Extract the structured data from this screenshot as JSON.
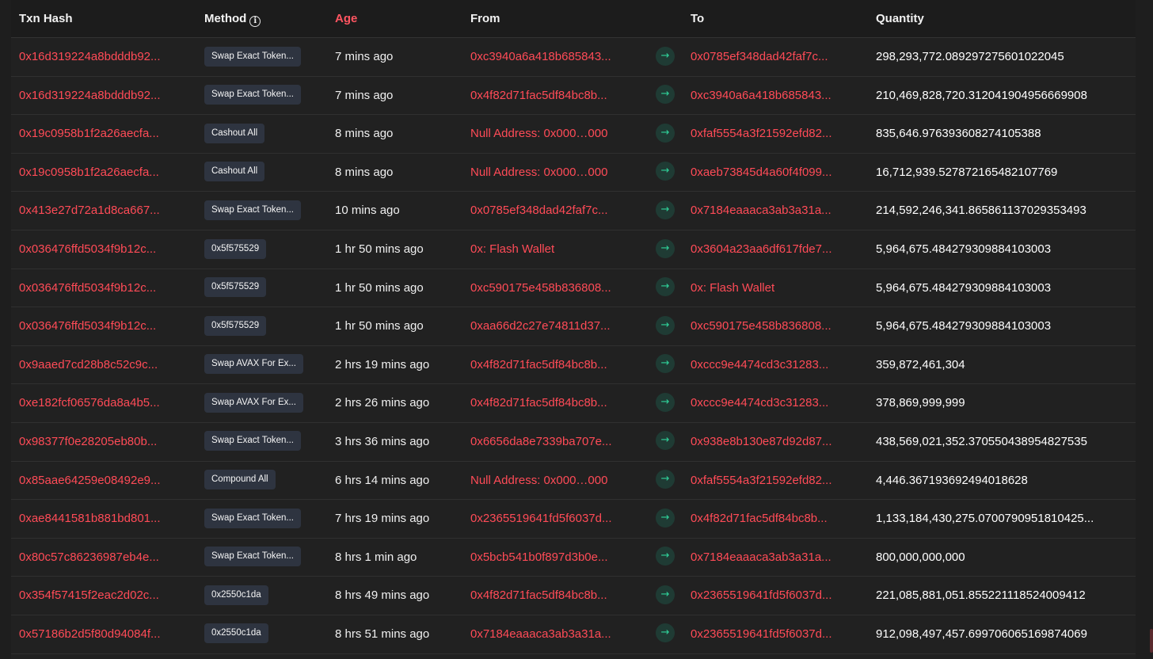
{
  "header": {
    "txn_hash": "Txn Hash",
    "method": "Method",
    "age": "Age",
    "from": "From",
    "to": "To",
    "quantity": "Quantity"
  },
  "colors": {
    "accent_red": "#ff4b57",
    "arrow_green": "#2fd39a",
    "badge_bg": "#2e3440"
  },
  "rows": [
    {
      "hash": "0x16d319224a8bdddb92...",
      "method": "Swap Exact Token...",
      "age": "7 mins ago",
      "from": "0xc3940a6a418b685843...",
      "to": "0x0785ef348dad42faf7c...",
      "quantity": "298,293,772.089297275601022045"
    },
    {
      "hash": "0x16d319224a8bdddb92...",
      "method": "Swap Exact Token...",
      "age": "7 mins ago",
      "from": "0x4f82d71fac5df84bc8b...",
      "to": "0xc3940a6a418b685843...",
      "quantity": "210,469,828,720.312041904956669908"
    },
    {
      "hash": "0x19c0958b1f2a26aecfa...",
      "method": "Cashout All",
      "age": "8 mins ago",
      "from": "Null Address: 0x000…000",
      "to": "0xfaf5554a3f21592efd82...",
      "quantity": "835,646.976393608274105388"
    },
    {
      "hash": "0x19c0958b1f2a26aecfa...",
      "method": "Cashout All",
      "age": "8 mins ago",
      "from": "Null Address: 0x000…000",
      "to": "0xaeb73845d4a60f4f099...",
      "quantity": "16,712,939.527872165482107769"
    },
    {
      "hash": "0x413e27d72a1d8ca667...",
      "method": "Swap Exact Token...",
      "age": "10 mins ago",
      "from": "0x0785ef348dad42faf7c...",
      "to": "0x7184eaaaca3ab3a31a...",
      "quantity": "214,592,246,341.865861137029353493"
    },
    {
      "hash": "0x036476ffd5034f9b12c...",
      "method": "0x5f575529",
      "age": "1 hr 50 mins ago",
      "from": "0x: Flash Wallet",
      "to": "0x3604a23aa6df617fde7...",
      "quantity": "5,964,675.484279309884103003"
    },
    {
      "hash": "0x036476ffd5034f9b12c...",
      "method": "0x5f575529",
      "age": "1 hr 50 mins ago",
      "from": "0xc590175e458b836808...",
      "to": "0x: Flash Wallet",
      "quantity": "5,964,675.484279309884103003"
    },
    {
      "hash": "0x036476ffd5034f9b12c...",
      "method": "0x5f575529",
      "age": "1 hr 50 mins ago",
      "from": "0xaa66d2c27e74811d37...",
      "to": "0xc590175e458b836808...",
      "quantity": "5,964,675.484279309884103003"
    },
    {
      "hash": "0x9aaed7cd28b8c52c9c...",
      "method": "Swap AVAX For Ex...",
      "age": "2 hrs 19 mins ago",
      "from": "0x4f82d71fac5df84bc8b...",
      "to": "0xccc9e4474cd3c31283...",
      "quantity": "359,872,461,304"
    },
    {
      "hash": "0xe182fcf06576da8a4b5...",
      "method": "Swap AVAX For Ex...",
      "age": "2 hrs 26 mins ago",
      "from": "0x4f82d71fac5df84bc8b...",
      "to": "0xccc9e4474cd3c31283...",
      "quantity": "378,869,999,999"
    },
    {
      "hash": "0x98377f0e28205eb80b...",
      "method": "Swap Exact Token...",
      "age": "3 hrs 36 mins ago",
      "from": "0x6656da8e7339ba707e...",
      "to": "0x938e8b130e87d92d87...",
      "quantity": "438,569,021,352.370550438954827535"
    },
    {
      "hash": "0x85aae64259e08492e9...",
      "method": "Compound All",
      "age": "6 hrs 14 mins ago",
      "from": "Null Address: 0x000…000",
      "to": "0xfaf5554a3f21592efd82...",
      "quantity": "4,446.367193692494018628"
    },
    {
      "hash": "0xae8441581b881bd801...",
      "method": "Swap Exact Token...",
      "age": "7 hrs 19 mins ago",
      "from": "0x2365519641fd5f6037d...",
      "to": "0x4f82d71fac5df84bc8b...",
      "quantity": "1,133,184,430,275.0700790951810425..."
    },
    {
      "hash": "0x80c57c86236987eb4e...",
      "method": "Swap Exact Token...",
      "age": "8 hrs 1 min ago",
      "from": "0x5bcb541b0f897d3b0e...",
      "to": "0x7184eaaaca3ab3a31a...",
      "quantity": "800,000,000,000"
    },
    {
      "hash": "0x354f57415f2eac2d02c...",
      "method": "0x2550c1da",
      "age": "8 hrs 49 mins ago",
      "from": "0x4f82d71fac5df84bc8b...",
      "to": "0x2365519641fd5f6037d...",
      "quantity": "221,085,881,051.855221118524009412"
    },
    {
      "hash": "0x57186b2d5f80d94084f...",
      "method": "0x2550c1da",
      "age": "8 hrs 51 mins ago",
      "from": "0x7184eaaaca3ab3a31a...",
      "to": "0x2365519641fd5f6037d...",
      "quantity": "912,098,497,457.699706065169874069"
    }
  ]
}
